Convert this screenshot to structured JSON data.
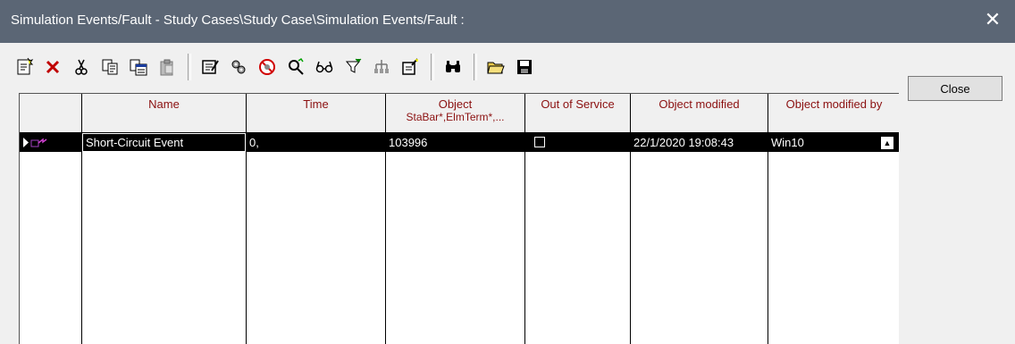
{
  "window": {
    "title": "Simulation Events/Fault - Study Cases\\Study Case\\Simulation Events/Fault :",
    "close_glyph": "✕"
  },
  "toolbar": {
    "icons": [
      "new-object-icon",
      "delete-icon",
      "cut-icon",
      "copy-icon",
      "copy-with-header-icon",
      "paste-icon",
      "edit-icon",
      "detail-icon",
      "out-of-service-icon",
      "mark-in-graphic-icon",
      "show-icon",
      "filter-icon",
      "tree-icon",
      "edit-filter-icon",
      "find-icon",
      "open-folder-icon",
      "save-icon"
    ]
  },
  "close_button": {
    "label": "Close"
  },
  "table": {
    "columns": [
      {
        "label": "Name",
        "sub": ""
      },
      {
        "label": "Time",
        "sub": ""
      },
      {
        "label": "Object",
        "sub": "StaBar*,ElmTerm*,..."
      },
      {
        "label": "Out of Service",
        "sub": ""
      },
      {
        "label": "Object modified",
        "sub": ""
      },
      {
        "label": "Object modified by",
        "sub": ""
      }
    ],
    "rows": [
      {
        "name": "Short-Circuit Event",
        "time": "0,",
        "object": "103996",
        "out_of_service": false,
        "modified": "22/1/2020 19:08:43",
        "modified_by": "Win10"
      }
    ]
  }
}
